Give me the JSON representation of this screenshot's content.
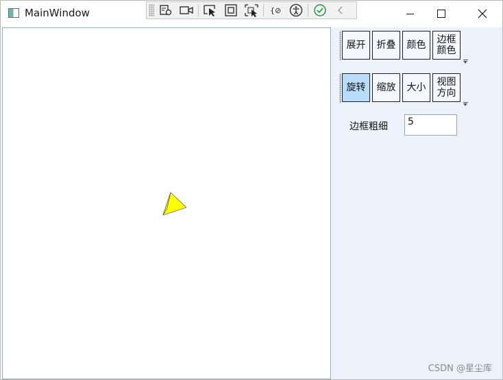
{
  "window": {
    "title": "MainWindow"
  },
  "devtools": {
    "icons": [
      "live-visual-tree-icon",
      "record-icon",
      "select-element-icon",
      "display-adorners-icon",
      "track-focus-icon",
      "binding-failures-icon",
      "accessibility-icon",
      "hot-reload-ok-icon",
      "collapse-icon"
    ]
  },
  "toolbar1": {
    "buttons": [
      "展开",
      "折叠",
      "颜色",
      "边框\n颜色"
    ]
  },
  "toolbar2": {
    "buttons": [
      "旋转",
      "缩放",
      "大小",
      "视图\n方向"
    ],
    "active_index": 0
  },
  "border_thickness": {
    "label": "边框粗细",
    "value": "5"
  },
  "watermark": "CSDN @星尘库",
  "colors": {
    "side_panel_bg": "#ebf2fb",
    "active_button": "#b9dcfa",
    "shape_fill": "#ffff00"
  }
}
